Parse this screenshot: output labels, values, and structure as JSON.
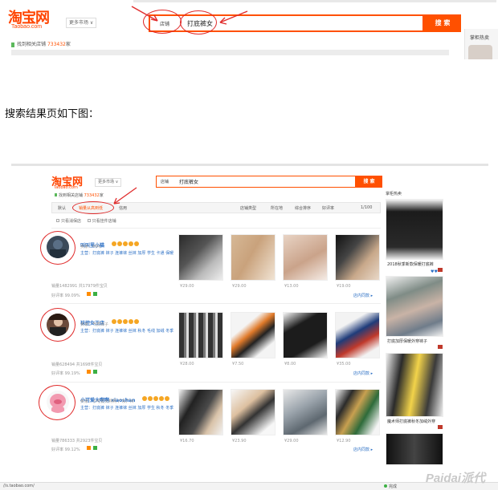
{
  "top": {
    "logo_cn": "淘宝网",
    "logo_en": "Taobao.com",
    "more_market": "更多市场 ∨",
    "scope_label": "店铺",
    "query": "打底裤女",
    "search_btn": "搜 索",
    "found_shops": "找到相关店铺",
    "found_count": "733432",
    "found_unit": "家",
    "right_label": "掌柜热卖"
  },
  "caption": "搜索结果页如下图：",
  "shot": {
    "logo_cn": "淘宝网",
    "logo_en": "Taobao.com",
    "more_market": "更多市场 ∨",
    "scope_label": "店铺",
    "query": "打底裤女",
    "search_btn": "搜 索",
    "found_shops": "找到相关店铺",
    "found_count": "733432",
    "found_unit": "家",
    "tabs": [
      "默认",
      "销量从高到低",
      "信用"
    ],
    "filters": [
      "店铺类型",
      "所在地",
      "综合排序",
      "好评率"
    ],
    "page_info": "1/100",
    "checkbox1": "只看消保店",
    "checkbox2": "只看挂件店铺",
    "right_title": "掌柜热卖",
    "shops": [
      {
        "name": "叫叫里小猫",
        "meta": "主营：打底裤 袜子 连裤袜 丝袜 加厚 学生 卡通 保暖",
        "seller": "卖家：叫叫",
        "sales": "销量1482991 共17979件宝贝",
        "rate": "好评率 99.09%",
        "prices": [
          "¥29.00",
          "¥29.00",
          "¥13.00",
          "¥19.00"
        ],
        "more": "店内同款 ▸"
      },
      {
        "name": "袜控女王店",
        "meta": "主营：打底裤 袜子 连裤袜 丝袜 秋冬 毛线 加绒 冬季",
        "seller": "卖家：气质袜子",
        "sales": "销量628494 共1698件宝贝",
        "rate": "好评率 99.19%",
        "prices": [
          "¥28.00",
          "¥7.50",
          "¥8.00",
          "¥35.00"
        ],
        "more": "店内同款 ▸"
      },
      {
        "name": "小可爱大啊啊 xiaoshan",
        "meta": "主营：打底裤 袜子 连裤袜 丝袜 加厚 学生 秋冬 冬季",
        "seller": "卖家：小可爱大啊啊 广东广州",
        "sales": "销量786333 共2923件宝贝",
        "rate": "好评率 99.12%",
        "prices": [
          "¥16.70",
          "¥23.90",
          "¥29.00",
          "¥12.90"
        ],
        "more": "店内同款 ▸"
      }
    ],
    "sidebar_captions": [
      "2018秋季新款保暖打底裤",
      "打底加厚保暖外穿袜子",
      "魔术师打底裤秋冬加绒外穿"
    ],
    "status_url": "//s.taobao.com/",
    "status_right": "完成",
    "watermark": "Paidai派代"
  },
  "colors": {
    "brand": "#ff5000",
    "link": "#2b6fc5",
    "annotation": "#e02b2b"
  }
}
